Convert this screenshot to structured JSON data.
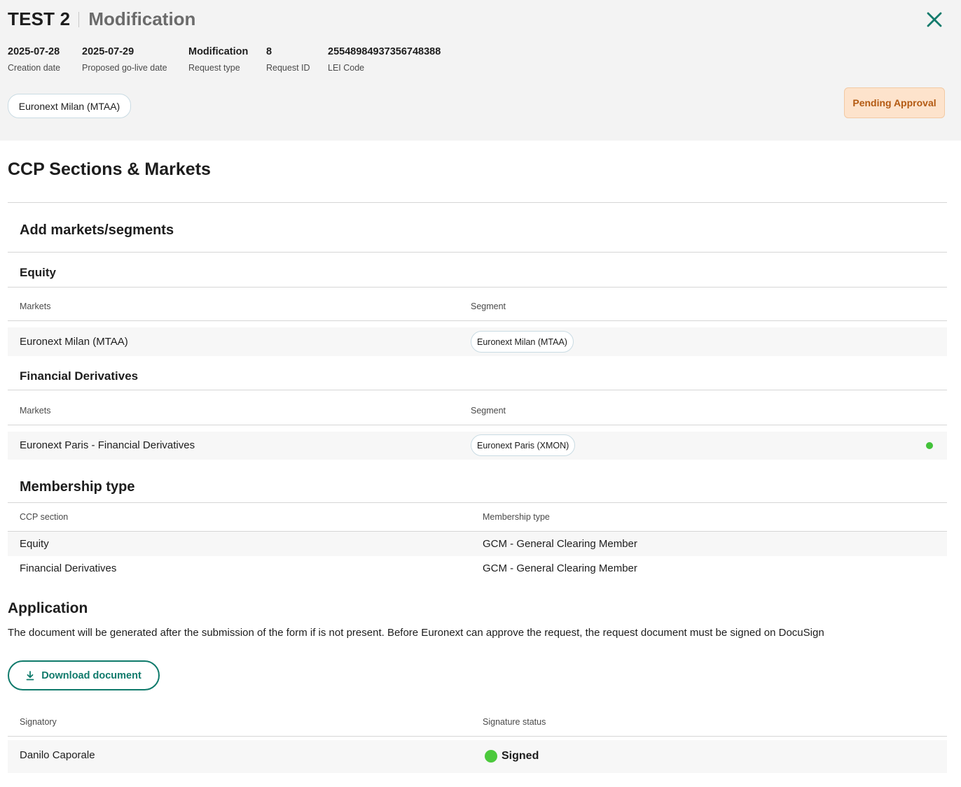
{
  "header": {
    "title": "TEST 2",
    "subtitle": "Modification",
    "meta": [
      {
        "value": "2025-07-28",
        "label": "Creation date"
      },
      {
        "value": "2025-07-29",
        "label": "Proposed go-live date"
      },
      {
        "value": "Modification",
        "label": "Request type"
      },
      {
        "value": "8",
        "label": "Request ID"
      },
      {
        "value": "25548984937356748388",
        "label": "LEI Code"
      }
    ],
    "market_chip": "Euronext Milan (MTAA)",
    "status": "Pending Approval",
    "close_icon": "close-icon"
  },
  "main": {
    "title": "CCP Sections & Markets",
    "add_markets_title": "Add markets/segments",
    "sections": [
      {
        "name": "Equity",
        "col_markets": "Markets",
        "col_segment": "Segment",
        "rows": [
          {
            "market": "Euronext Milan (MTAA)",
            "segment": "Euronext Milan (MTAA)"
          }
        ]
      },
      {
        "name": "Financial Derivatives",
        "col_markets": "Markets",
        "col_segment": "Segment",
        "rows": [
          {
            "market": "Euronext Paris - Financial Derivatives",
            "segment": "Euronext Paris (XMON)"
          }
        ]
      }
    ],
    "membership": {
      "title": "Membership type",
      "col_section": "CCP section",
      "col_type": "Membership type",
      "rows": [
        {
          "section": "Equity",
          "type": "GCM - General Clearing Member"
        },
        {
          "section": "Financial Derivatives",
          "type": "GCM - General Clearing Member"
        }
      ]
    },
    "application": {
      "title": "Application",
      "description": "The document will be generated after the submission of the form if is not present. Before Euronext can approve the request, the request document must be signed on DocuSign",
      "download_label": "Download document",
      "col_signatory": "Signatory",
      "col_status": "Signature status",
      "rows": [
        {
          "signatory": "Danilo Caporale",
          "status": "Signed"
        }
      ]
    }
  },
  "colors": {
    "accent": "#0f7a6b",
    "status_bg": "#fde3cc",
    "status_text": "#b35a12",
    "signed_green": "#4cc93c"
  }
}
